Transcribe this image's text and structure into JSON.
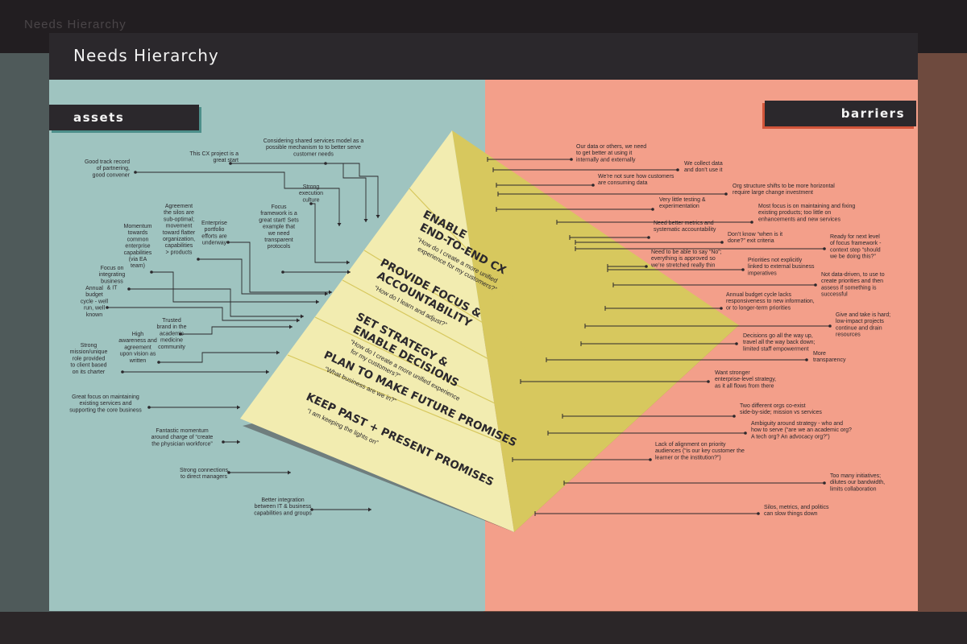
{
  "header": {
    "title": "Needs Hierarchy"
  },
  "sections": {
    "assets": "assets",
    "barriers": "barriers"
  },
  "colors": {
    "assets_bg": "#9fc4c0",
    "barriers_bg": "#f39f8a",
    "pyramid_face": "#f2ecb0",
    "pyramid_side": "#d7c85e",
    "header_bg": "#2b282c"
  },
  "tiers": [
    {
      "title": [
        "ENABLE",
        "END-TO-END CX"
      ],
      "quote": [
        "“How do I create a more unified",
        "experience for my customers?”"
      ]
    },
    {
      "title": [
        "PROVIDE FOCUS &",
        "ACCOUNTABILITY"
      ],
      "quote": [
        "“How do I learn and adjust?”"
      ]
    },
    {
      "title": [
        "SET STRATEGY &",
        "ENABLE DECISIONS"
      ],
      "quote": [
        "“How do I create a more unified experience",
        "for my customers?”"
      ]
    },
    {
      "title": [
        "PLAN TO MAKE FUTURE PROMISES"
      ],
      "quote": [
        "“What business are we in?”"
      ]
    },
    {
      "title": [
        "KEEP PAST + PRESENT PROMISES"
      ],
      "quote": [
        "“I am keeping the lights on”"
      ]
    }
  ],
  "assets": [
    {
      "lines": [
        "Considering shared services model as a",
        "possible mechanism to to better serve",
        "customer needs"
      ]
    },
    {
      "lines": [
        "This CX project is a",
        "great start"
      ]
    },
    {
      "lines": [
        "Good track record",
        "of partnering,",
        "good convener"
      ]
    },
    {
      "lines": [
        "Strong",
        "execution",
        "culture"
      ]
    },
    {
      "lines": [
        "Focus",
        "framework is a",
        "great start! Sets",
        "example that",
        "we need",
        "transparent",
        "protocols"
      ]
    },
    {
      "lines": [
        "Enterprise",
        "portfolio",
        "efforts are",
        "underway"
      ]
    },
    {
      "lines": [
        "Agreement",
        "the silos are",
        "sub-optimal;",
        "movement",
        "toward flatter",
        "organization,",
        "capabilities",
        "> products"
      ]
    },
    {
      "lines": [
        "Momentum",
        "towards",
        "common",
        "enterprise",
        "capabilities",
        "(via EA",
        "team)"
      ]
    },
    {
      "lines": [
        "Focus on",
        "integrating",
        "business",
        "& IT"
      ]
    },
    {
      "lines": [
        "Annual",
        "budget",
        "cycle - well",
        "run, well",
        "known"
      ]
    },
    {
      "lines": [
        "Trusted",
        "brand in the",
        "academic",
        "medicine",
        "community"
      ]
    },
    {
      "lines": [
        "High",
        "awareness and",
        "agreement",
        "upon vision as",
        "written"
      ]
    },
    {
      "lines": [
        "Strong",
        "mission/unique",
        "role provided",
        "to client based",
        "on its charter"
      ]
    },
    {
      "lines": [
        "Great focus on maintaining",
        "existing services and",
        "supporting the core business"
      ]
    },
    {
      "lines": [
        "Fantastic momentum",
        "around charge of “create",
        "the physician workforce”"
      ]
    },
    {
      "lines": [
        "Strong connections",
        "to direct managers"
      ]
    },
    {
      "lines": [
        "Better integration",
        "between IT & business",
        "capabilities and groups"
      ]
    }
  ],
  "barriers": [
    {
      "lines": [
        "Our data or others, we need",
        "to get better at using it",
        "internally and externally"
      ]
    },
    {
      "lines": [
        "We collect data",
        "and don’t use it"
      ]
    },
    {
      "lines": [
        "We’re not sure how customers",
        "are consuming data"
      ]
    },
    {
      "lines": [
        "Org structure shifts to be more horizontal",
        "require large change investment"
      ]
    },
    {
      "lines": [
        "Very little testing &",
        "experimentation"
      ]
    },
    {
      "lines": [
        "Most focus is on maintaining and fixing",
        "existing products; too little on",
        "enhancements and new services"
      ]
    },
    {
      "lines": [
        "Need better metrics and",
        "systematic accountability"
      ]
    },
    {
      "lines": [
        "Don’t know “when is it",
        "done?” exit criteria"
      ]
    },
    {
      "lines": [
        "Ready for next level",
        "of focus framework -",
        "context step “should",
        "we be doing this?”"
      ]
    },
    {
      "lines": [
        "Need to be able to say “No”;",
        "everything is approved so",
        "we’re stretched really thin"
      ]
    },
    {
      "lines": [
        "Priorities not explicitly",
        "linked to external business",
        "imperatives"
      ]
    },
    {
      "lines": [
        "Not data-driven, to use to",
        "create priorities and then",
        "assess if something is",
        "successful"
      ]
    },
    {
      "lines": [
        "Annual budget cycle lacks",
        "responsiveness to new information,",
        "or to longer-term priorities"
      ]
    },
    {
      "lines": [
        "Give and take is hard;",
        "low-impact projects",
        "continue and drain",
        "resources"
      ]
    },
    {
      "lines": [
        "Decisions go all the way up,",
        "travel all the way back down;",
        "limited staff empowerment"
      ]
    },
    {
      "lines": [
        "More",
        "transparency"
      ]
    },
    {
      "lines": [
        "Want stronger",
        "enterprise-level strategy,",
        "as it all flows from there"
      ]
    },
    {
      "lines": [
        "Two different orgs co-exist",
        "side-by-side; mission vs services"
      ]
    },
    {
      "lines": [
        "Ambiguity around strategy - who and",
        "how to serve (“are we an academic org?",
        "A tech org? An advocacy org?”)"
      ]
    },
    {
      "lines": [
        "Lack of alignment on priority",
        "audiences (“is our key customer the",
        "learner or the institution?”)"
      ]
    },
    {
      "lines": [
        "Too many initiatives;",
        "dilutes our bandwidth,",
        "limits collaboration"
      ]
    },
    {
      "lines": [
        "Silos, metrics, and politics",
        "can slow things down"
      ]
    }
  ]
}
